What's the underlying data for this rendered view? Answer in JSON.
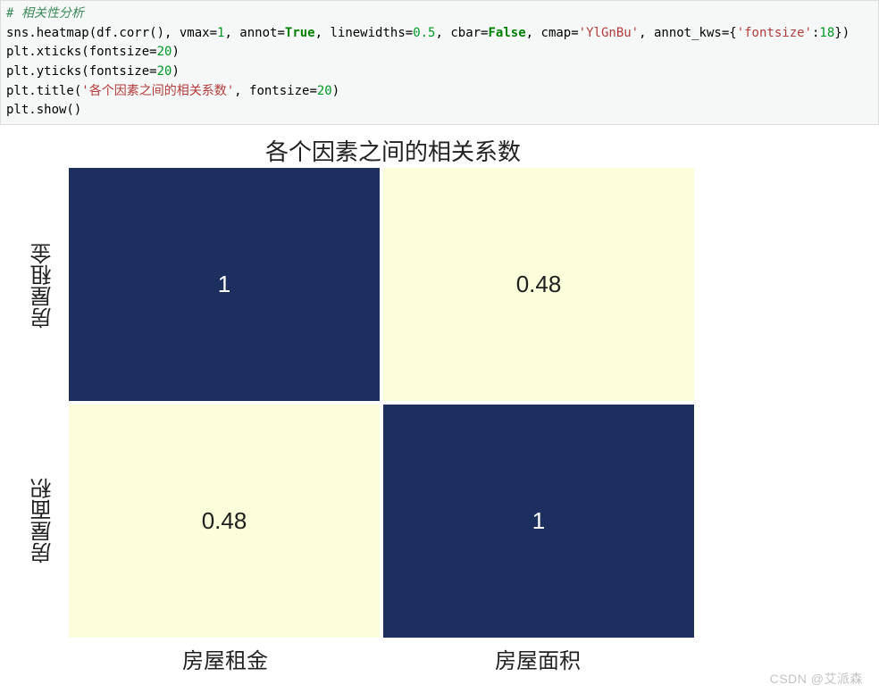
{
  "code": {
    "line1_comment": "# 相关性分析",
    "line2_pre": "sns.heatmap(df.corr(), vmax=",
    "line2_vmax": "1",
    "line2_annot_pre": ", annot=",
    "line2_annot": "True",
    "line2_lw_pre": ", linewidths=",
    "line2_lw": "0.5",
    "line2_cbar_pre": ", cbar=",
    "line2_cbar": "False",
    "line2_cmap_pre": ", cmap=",
    "line2_cmap": "'YlGnBu'",
    "line2_kws_pre": ", annot_kws={",
    "line2_kws_key": "'fontsize'",
    "line2_kws_colon": ":",
    "line2_kws_val": "18",
    "line2_end": "})",
    "line3_pre": "plt.xticks(fontsize=",
    "line3_val": "20",
    "line3_end": ")",
    "line4_pre": "plt.yticks(fontsize=",
    "line4_val": "20",
    "line4_end": ")",
    "line5_pre": "plt.title(",
    "line5_str": "'各个因素之间的相关系数'",
    "line5_mid": ", fontsize=",
    "line5_val": "20",
    "line5_end": ")",
    "line6": "plt.show()"
  },
  "chart_data": {
    "type": "heatmap",
    "title": "各个因素之间的相关系数",
    "xlabels": [
      "房屋租金",
      "房屋面积"
    ],
    "ylabels": [
      "房屋租金",
      "房屋面积"
    ],
    "values": [
      [
        1,
        0.48
      ],
      [
        0.48,
        1
      ]
    ],
    "display_values": [
      [
        "1",
        "0.48"
      ],
      [
        "0.48",
        "1"
      ]
    ],
    "vmax": 1,
    "cmap": "YlGnBu",
    "linewidths": 0.5,
    "cbar": false,
    "annot_fontsize": 18,
    "tick_fontsize": 20,
    "title_fontsize": 20
  },
  "watermark": "CSDN @艾派森"
}
